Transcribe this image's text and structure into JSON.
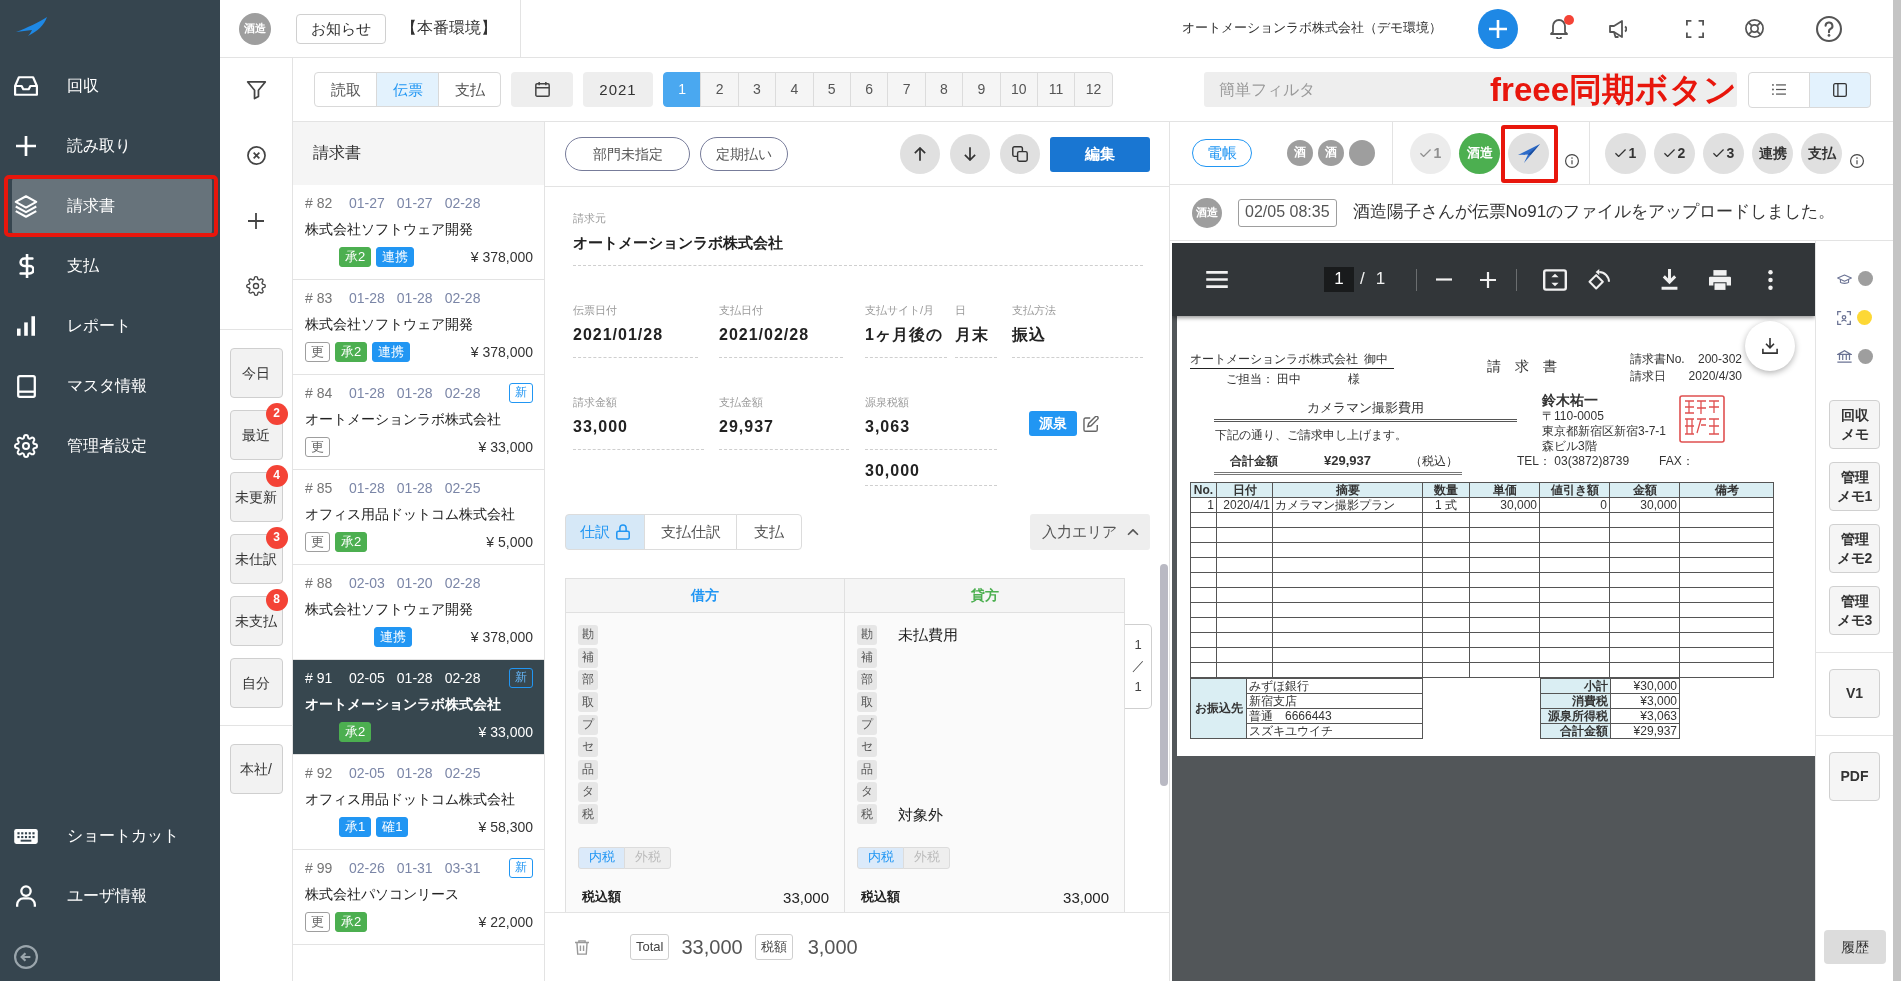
{
  "sidebar": {
    "items": [
      {
        "label": "回収",
        "selected": false,
        "annotated": false
      },
      {
        "label": "読み取り",
        "selected": false,
        "annotated": false
      },
      {
        "label": "請求書",
        "selected": true,
        "annotated": true
      },
      {
        "label": "支払",
        "selected": false,
        "annotated": false
      },
      {
        "label": "レポート",
        "selected": false,
        "annotated": false
      },
      {
        "label": "マスタ情報",
        "selected": false,
        "annotated": false
      },
      {
        "label": "管理者設定",
        "selected": false,
        "annotated": false
      }
    ],
    "bottom_items": [
      {
        "label": "ショートカット"
      },
      {
        "label": "ユーザ情報"
      }
    ]
  },
  "topbar": {
    "avatar": "酒造",
    "notice_button": "お知らせ",
    "environment": "【本番環境】",
    "company": "オートメーションラボ株式会社（デモ環境）",
    "has_unread": true
  },
  "filter_rail": {
    "quick_filters": [
      {
        "label": "今日"
      },
      {
        "label": "最近",
        "count": "2"
      },
      {
        "label": "未更新",
        "count": "4"
      },
      {
        "label": "未仕訳",
        "count": "3"
      },
      {
        "label": "未支払",
        "count": "8"
      },
      {
        "label": "自分"
      }
    ],
    "branch_filter": "本社/"
  },
  "toolbar": {
    "source_tabs": [
      {
        "label": "読取",
        "selected": false
      },
      {
        "label": "伝票",
        "selected": true
      },
      {
        "label": "支払",
        "selected": false
      }
    ],
    "year": "2021",
    "months": [
      {
        "label": "1",
        "selected": true
      },
      {
        "label": "2",
        "selected": false
      },
      {
        "label": "3",
        "selected": false
      },
      {
        "label": "4",
        "selected": false
      },
      {
        "label": "5",
        "selected": false
      },
      {
        "label": "6",
        "selected": false
      },
      {
        "label": "7",
        "selected": false
      },
      {
        "label": "8",
        "selected": false
      },
      {
        "label": "9",
        "selected": false
      },
      {
        "label": "10",
        "selected": false
      },
      {
        "label": "11",
        "selected": false
      },
      {
        "label": "12",
        "selected": false
      }
    ],
    "filter": {
      "placeholder": "簡単フィルタ"
    },
    "view_modes": [
      {
        "selected": false
      },
      {
        "selected": true
      }
    ]
  },
  "annotation": {
    "label": "freee同期ボタン"
  },
  "invoice_list": {
    "title": "請求書",
    "items": [
      {
        "number": "# 82",
        "dates": [
          "01-27",
          "01-27",
          "02-28"
        ],
        "vendor": "株式会社ソフトウェア開発",
        "tags": [
          {
            "text": "承2",
            "kind": "approval",
            "color": "#4caf50"
          },
          {
            "text": "連携",
            "kind": "link",
            "color": "#2196f3"
          }
        ],
        "amount": "¥ 378,000",
        "selected": false
      },
      {
        "number": "# 83",
        "dates": [
          "01-28",
          "01-28",
          "02-28"
        ],
        "vendor": "株式会社ソフトウェア開発",
        "tags": [
          {
            "text": "更",
            "kind": "update"
          },
          {
            "text": "承2",
            "kind": "approval",
            "color": "#4caf50"
          },
          {
            "text": "連携",
            "kind": "link",
            "color": "#2196f3"
          }
        ],
        "amount": "¥ 378,000",
        "selected": false
      },
      {
        "number": "# 84",
        "dates": [
          "01-28",
          "01-28",
          "02-28"
        ],
        "badge": "新",
        "vendor": "オートメーションラボ株式会社",
        "tags": [
          {
            "text": "更",
            "kind": "update"
          }
        ],
        "amount": "¥ 33,000",
        "selected": false
      },
      {
        "number": "# 85",
        "dates": [
          "01-28",
          "01-28",
          "02-25"
        ],
        "vendor": "オフィス用品ドットコム株式会社",
        "tags": [
          {
            "text": "更",
            "kind": "update"
          },
          {
            "text": "承2",
            "kind": "approval",
            "color": "#4caf50"
          }
        ],
        "amount": "¥ 5,000",
        "selected": false
      },
      {
        "number": "# 88",
        "dates": [
          "02-03",
          "01-20",
          "02-28"
        ],
        "vendor": "株式会社ソフトウェア開発",
        "tags": [
          {
            "text": "連携",
            "kind": "link",
            "color": "#2196f3"
          }
        ],
        "amount": "¥ 378,000",
        "selected": false
      },
      {
        "number": "# 91",
        "dates": [
          "02-05",
          "01-28",
          "02-28"
        ],
        "badge": "新",
        "vendor": "オートメーションラボ株式会社",
        "tags": [
          {
            "text": "承2",
            "kind": "approval",
            "color": "#4caf50"
          }
        ],
        "amount": "¥ 33,000",
        "selected": true
      },
      {
        "number": "# 92",
        "dates": [
          "02-05",
          "01-28",
          "02-25"
        ],
        "vendor": "オフィス用品ドットコム株式会社",
        "tags": [
          {
            "text": "承1",
            "kind": "approval",
            "color": "#2196f3"
          },
          {
            "text": "確1",
            "kind": "confirm",
            "color": "#2196f3"
          }
        ],
        "amount": "¥ 58,300",
        "selected": false
      },
      {
        "number": "# 99",
        "dates": [
          "02-26",
          "01-31",
          "03-31"
        ],
        "badge": "新",
        "vendor": "株式会社パソコンリース",
        "tags": [
          {
            "text": "更",
            "kind": "update"
          },
          {
            "text": "承2",
            "kind": "approval",
            "color": "#4caf50"
          }
        ],
        "amount": "¥ 22,000",
        "selected": false
      }
    ]
  },
  "detail": {
    "tag_buttons": [
      "部門未指定",
      "定期払い"
    ],
    "edit_button": "編集",
    "vendor": {
      "label": "請求元",
      "value": "オートメーションラボ株式会社"
    },
    "date_fields": [
      {
        "label": "伝票日付",
        "value": "2021/01/28"
      },
      {
        "label": "支払日付",
        "value": "2021/02/28"
      },
      {
        "label": "支払サイト/月",
        "value": "1ヶ月後の"
      },
      {
        "label": "日",
        "value": "月末"
      },
      {
        "label": "支払方法",
        "value": "振込"
      }
    ],
    "amount_fields": [
      {
        "label": "請求金額",
        "value": "33,000"
      },
      {
        "label": "支払金額",
        "value": "29,937"
      },
      {
        "label": "源泉税額",
        "value": "3,063",
        "extra_value": "30,000"
      }
    ],
    "withholding_badge": "源泉",
    "tabs": [
      {
        "label": "仕訳",
        "selected": true,
        "locked": true
      },
      {
        "label": "支払仕訳",
        "selected": false,
        "locked": false
      },
      {
        "label": "支払",
        "selected": false,
        "locked": false
      }
    ],
    "input_area": {
      "label": "入力エリア",
      "expanded": true
    },
    "journal": {
      "sides": [
        {
          "kind": "debit",
          "title": "借方",
          "rows": [
            {
              "key": "勘"
            },
            {
              "key": "補"
            },
            {
              "key": "部"
            },
            {
              "key": "取"
            },
            {
              "key": "プ"
            },
            {
              "key": "セ"
            },
            {
              "key": "品"
            },
            {
              "key": "タ"
            },
            {
              "key": "税"
            }
          ],
          "tax_modes": [
            {
              "label": "内税",
              "selected": true
            },
            {
              "label": "外税",
              "selected": false
            }
          ],
          "total_label": "税込額",
          "total": "33,000"
        },
        {
          "kind": "credit",
          "title": "貸方",
          "rows": [
            {
              "key": "勘",
              "value": "未払費用"
            },
            {
              "key": "補"
            },
            {
              "key": "部"
            },
            {
              "key": "取"
            },
            {
              "key": "プ"
            },
            {
              "key": "セ"
            },
            {
              "key": "品"
            },
            {
              "key": "タ"
            },
            {
              "key": "税",
              "value": "対象外"
            }
          ],
          "tax_modes": [
            {
              "label": "内税",
              "selected": true
            },
            {
              "label": "外税",
              "selected": false
            }
          ],
          "total_label": "税込額",
          "total": "33,000"
        }
      ],
      "pager": {
        "current": "1",
        "separator": "／",
        "total": "1"
      }
    },
    "footer": {
      "total_label": "Total",
      "total": "33,000",
      "tax_label": "税額",
      "tax": "3,000"
    }
  },
  "record_status": {
    "ledger_badge": "電帳",
    "stamps": [
      {
        "kind": "initial",
        "text": "酒"
      },
      {
        "kind": "initial",
        "text": "酒"
      },
      {
        "kind": "blank"
      }
    ],
    "sync_steps": [
      {
        "kind": "check",
        "label": "1",
        "disabled": true,
        "annotated": false
      },
      {
        "kind": "stamp",
        "label": "酒造",
        "disabled": false,
        "annotated": false
      },
      {
        "kind": "freee",
        "disabled": false,
        "annotated": true
      }
    ],
    "approval_steps": [
      {
        "kind": "check",
        "label": "1"
      },
      {
        "kind": "check",
        "label": "2"
      },
      {
        "kind": "check",
        "label": "3"
      },
      {
        "kind": "text",
        "label": "連携"
      },
      {
        "kind": "text",
        "label": "支払"
      }
    ]
  },
  "activity": {
    "avatar": "酒造",
    "time": "02/05 08:35",
    "message": "酒造陽子さんが伝票No91のファイルをアップロードしました。"
  },
  "pdf_viewer": {
    "page": "1",
    "separator": "/",
    "page_count": "1",
    "document": {
      "recipient": "オートメーションラボ株式会社",
      "recipient_suffix": "御中",
      "contact": "ご担当： 田中",
      "contact_suffix": "様",
      "title": "請　求　書",
      "meta": [
        {
          "label": "請求書No.",
          "value": "200-302"
        },
        {
          "label": "請求日",
          "value": "2020/4/30"
        }
      ],
      "subject": "カメラマン撮影費用",
      "greeting": "下記の通り、ご請求申し上げます。",
      "total": {
        "label": "合計金額",
        "value": "¥29,937",
        "note": "（税込）"
      },
      "issuer": {
        "name": "鈴木祐一",
        "address": [
          "〒110-0005",
          "東京都新宿区新宿3-7-1",
          "森ビル3階"
        ],
        "tel": "TEL： 03(3872)8739",
        "fax": "FAX："
      },
      "items_table": {
        "columns": [
          "No.",
          "日付",
          "摘要",
          "数量",
          "単価",
          "値引き額",
          "金額",
          "備考"
        ],
        "rows": [
          [
            "1",
            "2020/4/1",
            "カメラマン撮影プラン",
            "1 式",
            "30,000",
            "0",
            "30,000"
          ]
        ]
      },
      "bank": {
        "label": "お振込先",
        "lines": [
          "みずほ銀行",
          "新宿支店",
          "普通　6666443",
          "スズキユウイチ"
        ]
      },
      "summary": [
        {
          "label": "小計",
          "value": "¥30,000"
        },
        {
          "label": "消費税",
          "value": "¥3,000"
        },
        {
          "label": "源泉所得税",
          "value": "¥3,063"
        },
        {
          "label": "合計金額",
          "value": "¥29,937"
        }
      ]
    }
  },
  "side_rail": {
    "indicators": [
      {
        "color": "#9e9e9e"
      },
      {
        "color": "#fdd835"
      },
      {
        "color": "#9e9e9e"
      }
    ],
    "memo_buttons": [
      "回収メモ",
      "管理メモ1",
      "管理メモ2",
      "管理メモ3"
    ],
    "version_button": "V1",
    "pdf_button": "PDF",
    "history_button": "履歴"
  }
}
